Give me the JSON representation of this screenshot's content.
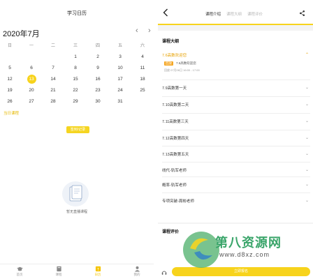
{
  "left": {
    "title": "学习日历",
    "month": "2020年7月",
    "prev_icon": "chevron-left-icon",
    "next_icon": "chevron-right-icon",
    "weekdays": [
      "日",
      "一",
      "二",
      "三",
      "四",
      "五",
      "六"
    ],
    "weeks": [
      [
        "",
        "",
        "",
        "1",
        "2",
        "3",
        "4"
      ],
      [
        "5",
        "6",
        "7",
        "8",
        "9",
        "10",
        "11"
      ],
      [
        "12",
        "13",
        "14",
        "15",
        "16",
        "17",
        "18"
      ],
      [
        "19",
        "20",
        "21",
        "22",
        "23",
        "24",
        "25"
      ],
      [
        "26",
        "27",
        "28",
        "29",
        "30",
        "31",
        ""
      ]
    ],
    "selected_day": "13",
    "today_lesson": "当日课程",
    "checkin_button": "签到/记录",
    "empty_text": "暂无直播课程",
    "tabs": [
      {
        "label": "首页",
        "icon": "graduation-cap-icon"
      },
      {
        "label": "课程",
        "icon": "book-icon"
      },
      {
        "label": "日历",
        "icon": "calendar-icon"
      },
      {
        "label": "我的",
        "icon": "user-icon"
      }
    ],
    "active_tab": 2
  },
  "right": {
    "back_icon": "back-arrow-icon",
    "share_icon": "share-icon",
    "tabs": [
      "课程介绍",
      "课程大纲",
      "课程评价"
    ],
    "active_tab": 0,
    "outline_title": "课程大纲",
    "outline": [
      "7.6高数欢迎您",
      "7.9高数第一天",
      "7.10高数第二天",
      "7.11高数第三天",
      "7.12高数第四天",
      "7.13高数第五天",
      "线代-轨军老师",
      "概率-轨军老师",
      "专项突破-周彬老师"
    ],
    "live": {
      "badge": "回放",
      "name": "7.6高数欢迎您",
      "time": "回放 07月06日 16:00 - 17:00"
    },
    "review_title": "课程评价",
    "home_label": "客服",
    "action_button": "立即报名"
  },
  "watermark": {
    "text": "第八资源网",
    "url": "www.d8xz.com"
  },
  "colors": {
    "accent": "#f7d31c",
    "accent_text": "#e6a100"
  }
}
